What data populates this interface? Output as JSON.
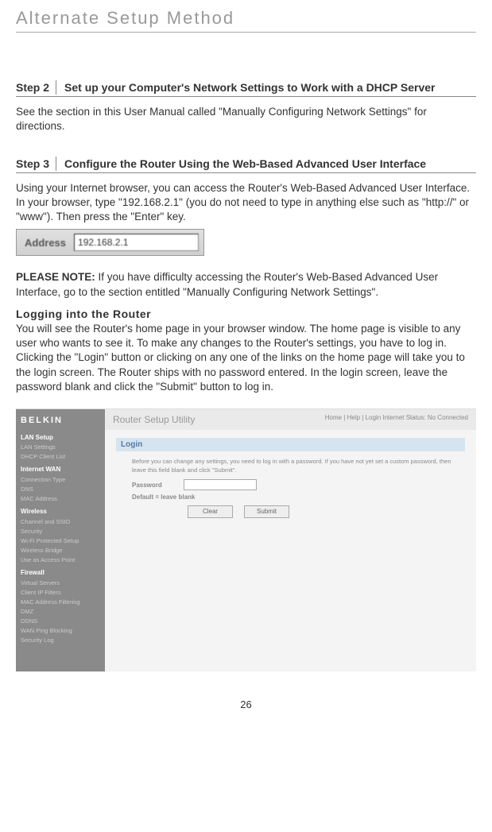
{
  "pageTitle": "Alternate Setup Method",
  "step2": {
    "label": "Step 2",
    "title": "Set up your Computer's Network Settings to Work with a DHCP Server",
    "body": "See the section in this User Manual called \"Manually Configuring Network Settings\" for directions."
  },
  "step3": {
    "label": "Step 3",
    "title": "Configure the Router Using the Web-Based Advanced User Interface",
    "body": "Using your Internet browser, you can access the Router's Web-Based Advanced User Interface. In your browser, type \"192.168.2.1\" (you do not need to type in anything else such as \"http://\" or \"www\"). Then press the \"Enter\" key."
  },
  "addressBar": {
    "label": "Address",
    "value": "192.168.2.1"
  },
  "pleaseNote": {
    "label": "PLEASE NOTE:",
    "text": " If you have difficulty accessing the Router's Web-Based Advanced User Interface, go to the section entitled \"Manually Configuring Network Settings\"."
  },
  "loggingIn": {
    "heading": "Logging into the Router",
    "body": "You will see the Router's home page in your browser window. The home page is visible to any user who wants to see it. To make any changes to the Router's settings, you have to log in. Clicking the \"Login\" button or clicking on any one of the links on the home page will take you to the login screen. The Router ships with no password entered. In the login screen, leave the password blank and click the \"Submit\" button to log in."
  },
  "routerUI": {
    "brand": "BELKIN",
    "topTitle": "Router Setup Utility",
    "topRight": "Home | Help | Login    Internet Status: No Connected",
    "sidebar": {
      "cat1": "LAN Setup",
      "items1": [
        "LAN Settings",
        "DHCP Client List"
      ],
      "cat2": "Internet WAN",
      "items2": [
        "Connection Type",
        "DNS",
        "MAC Address"
      ],
      "cat3": "Wireless",
      "items3": [
        "Channel and SSID",
        "Security",
        "Wi-Fi Protected Setup",
        "Wireless Bridge",
        "Use as Access Point"
      ],
      "cat4": "Firewall",
      "items4": [
        "Virtual Servers",
        "Client IP Filters",
        "MAC Address Filtering",
        "DMZ",
        "DDNS",
        "WAN Ping Blocking",
        "Security Log"
      ]
    },
    "login": {
      "heading": "Login",
      "helpText": "Before you can change any settings, you need to log in with a password. If you have not yet set a custom password, then leave this field blank and click \"Submit\".",
      "passwordLabel": "Password",
      "defaultNote": "Default = leave blank",
      "clearBtn": "Clear",
      "submitBtn": "Submit"
    }
  },
  "pageNumber": "26"
}
